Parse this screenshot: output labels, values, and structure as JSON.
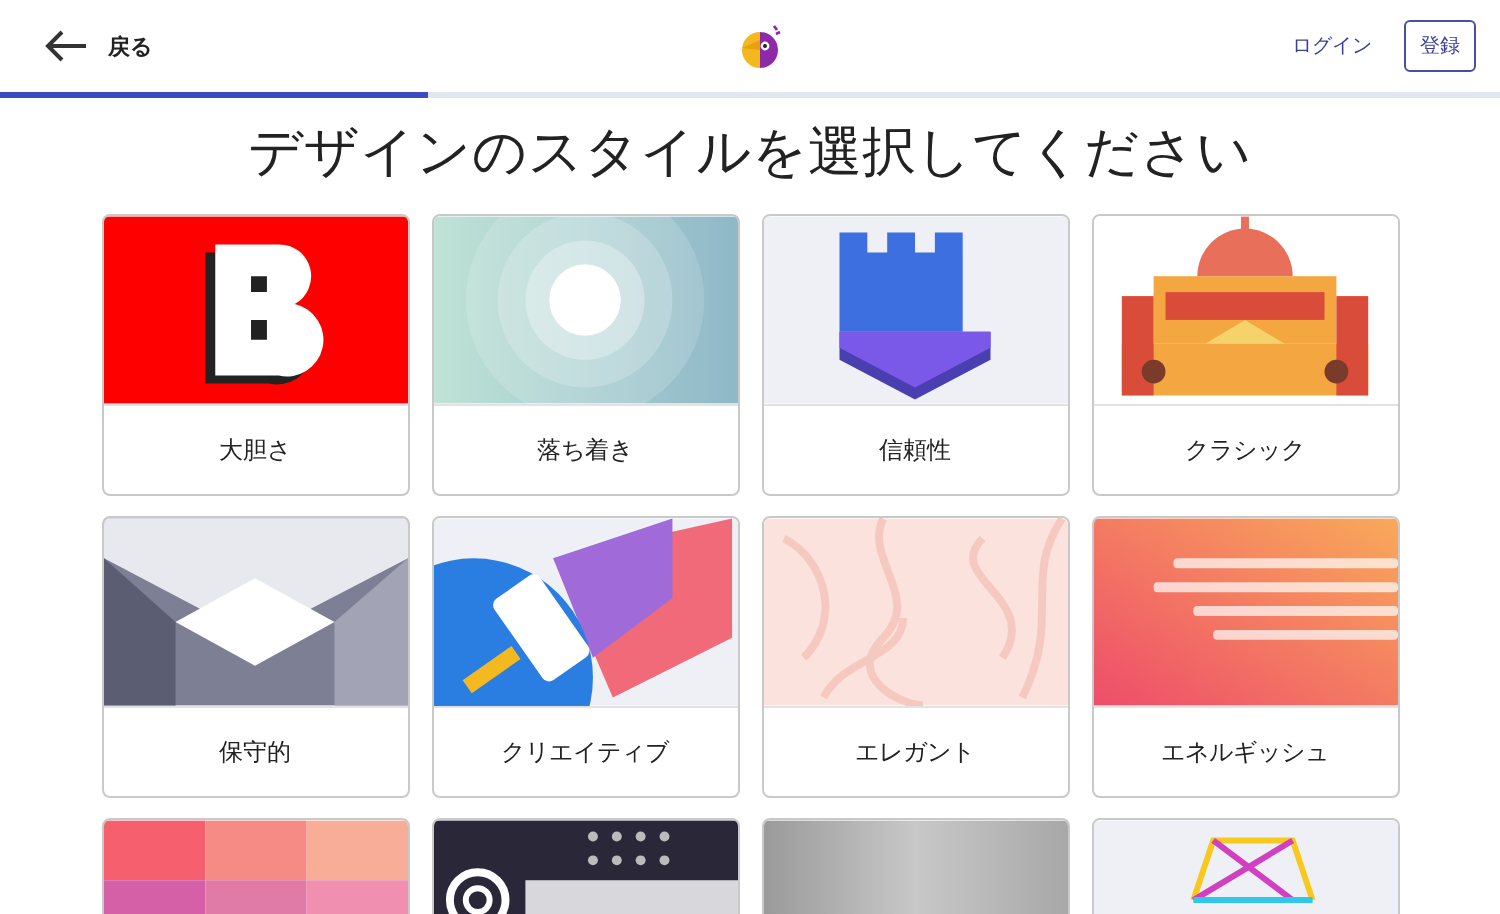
{
  "header": {
    "back_label": "戻る",
    "login_link": "ログイン",
    "register_button": "登録",
    "progress": {
      "level": 0.285
    }
  },
  "title": "デザインのスタイルを選択してください",
  "cards": [
    {
      "kind": "bold",
      "label": "大胆さ"
    },
    {
      "kind": "calm",
      "label": "落ち着き"
    },
    {
      "kind": "trust",
      "label": "信頼性"
    },
    {
      "kind": "classic",
      "label": "クラシック"
    },
    {
      "kind": "conservative",
      "label": "保守的"
    },
    {
      "kind": "creative",
      "label": "クリエイティブ"
    },
    {
      "kind": "elegant",
      "label": "エレガント"
    },
    {
      "kind": "energetic",
      "label": "エネルギッシュ"
    },
    {
      "kind": "palette"
    },
    {
      "kind": "dark"
    },
    {
      "kind": "metal"
    },
    {
      "kind": "geometric"
    }
  ]
}
